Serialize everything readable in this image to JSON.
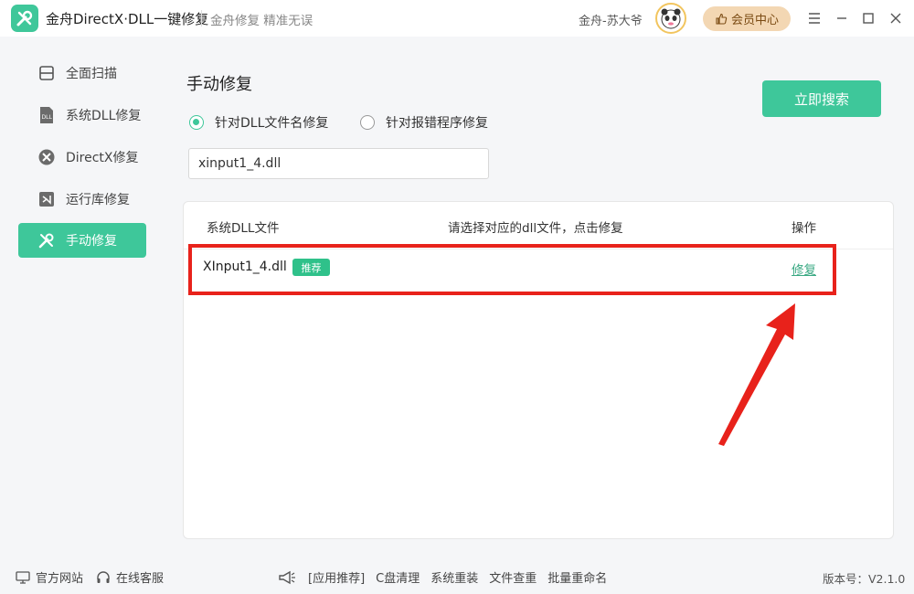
{
  "titlebar": {
    "app_title": "金舟DirectX·DLL一键修复",
    "slogan": "金舟修复 精准无误",
    "user_name": "金舟-苏大爷",
    "vip_label": "会员中心"
  },
  "sidebar": {
    "items": [
      {
        "label": "全面扫描",
        "icon": "scan-icon"
      },
      {
        "label": "系统DLL修复",
        "icon": "dll-file-icon"
      },
      {
        "label": "DirectX修复",
        "icon": "directx-icon"
      },
      {
        "label": "运行库修复",
        "icon": "visual-studio-icon"
      },
      {
        "label": "手动修复",
        "icon": "tools-icon"
      }
    ],
    "active_index": 4
  },
  "main": {
    "title": "手动修复",
    "search_button": "立即搜索",
    "radio_options": [
      {
        "label": "针对DLL文件名修复",
        "checked": true
      },
      {
        "label": "针对报错程序修复",
        "checked": false
      }
    ],
    "dll_input_value": "xinput1_4.dll",
    "table": {
      "headers": [
        "系统DLL文件",
        "请选择对应的dll文件，点击修复",
        "操作"
      ],
      "rows": [
        {
          "name": "XInput1_4.dll",
          "badge": "推荐",
          "action": "修复"
        }
      ]
    }
  },
  "footer": {
    "website": "官方网站",
    "service": "在线客服",
    "links": [
      "[应用推荐]",
      "C盘清理",
      "系统重装",
      "文件查重",
      "批量重命名"
    ],
    "version": "版本号：V2.1.0"
  },
  "colors": {
    "accent": "#3ec79a",
    "highlight": "#e8221b",
    "vip_bg": "#f3d7b3"
  }
}
